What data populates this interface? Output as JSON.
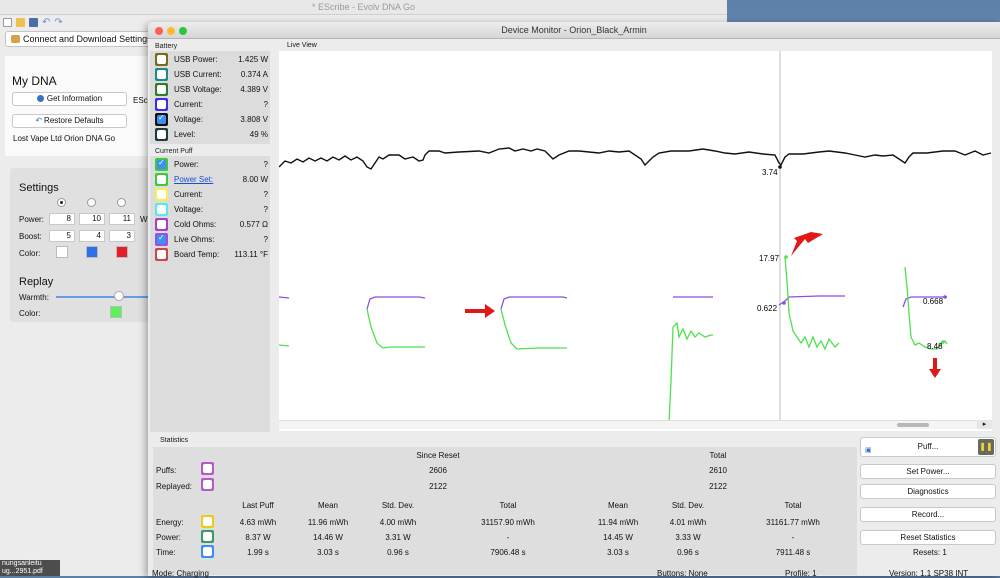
{
  "bg_window": {
    "title": "* EScribe - Evolv DNA Go",
    "connect_button": "Connect and Download Settings",
    "my_dna_title": "My DNA",
    "get_info_button": "Get Information",
    "escribe_label": "ESc",
    "restore_button": "Restore Defaults",
    "device_name": "Lost Vape Ltd Orion DNA Go",
    "settings_title": "Settings",
    "power_label": "Power:",
    "power_values": [
      "8",
      "10",
      "11"
    ],
    "power_unit": "W",
    "boost_label": "Boost:",
    "boost_values": [
      "5",
      "4",
      "3"
    ],
    "color_label": "Color:",
    "color_swatches": [
      "#ffffff",
      "#2f6fe8",
      "#e3202a"
    ],
    "replay_title": "Replay",
    "warmth_label": "Warmth:",
    "replay_color_label": "Color:",
    "replay_color": "#5cf05a",
    "warmth_level": 0.67,
    "desktop_text": [
      "nungsanleitu",
      "ug...2951.pdf"
    ]
  },
  "monitor": {
    "title": "Device Monitor - Orion_Black_Armin",
    "battery_label": "Battery",
    "battery": [
      {
        "name": "USB Power:",
        "value": "1.425 W",
        "color": "#7b6a1a",
        "checked": false
      },
      {
        "name": "USB Current:",
        "value": "0.374 A",
        "color": "#1a8a8a",
        "checked": false
      },
      {
        "name": "USB Voltage:",
        "value": "4.389 V",
        "color": "#2e7d2e",
        "checked": false
      },
      {
        "name": "Current:",
        "value": "?",
        "color": "#3b2de0",
        "checked": false
      },
      {
        "name": "Voltage:",
        "value": "3.808 V",
        "color": "#111111",
        "checked": true
      },
      {
        "name": "Level:",
        "value": "49 %",
        "color": "#1d3b3b",
        "checked": false
      }
    ],
    "current_puff_label": "Current Puff",
    "current_puff": [
      {
        "name": "Power:",
        "value": "?",
        "color": "#3ec83e",
        "checked": true,
        "link": false
      },
      {
        "name": "Power Set:",
        "value": "8.00 W",
        "color": "#3ec83e",
        "checked": false,
        "link": true
      },
      {
        "name": "Current:",
        "value": "?",
        "color": "#f0f05a",
        "checked": false,
        "link": false
      },
      {
        "name": "Voltage:",
        "value": "?",
        "color": "#5ae8e8",
        "checked": false,
        "link": false
      },
      {
        "name": "Cold Ohms:",
        "value": "0.577 Ω",
        "color": "#a340c8",
        "checked": false,
        "link": false
      },
      {
        "name": "Live Ohms:",
        "value": "?",
        "color": "#9a4fe0",
        "checked": true,
        "link": false
      },
      {
        "name": "Board Temp:",
        "value": "113.11 °F",
        "color": "#c84848",
        "checked": false,
        "link": false
      }
    ],
    "live_view_label": "Live View",
    "annotations": [
      "3.74",
      "17.97",
      "0.622",
      "0.668",
      "8.48"
    ],
    "statistics_label": "Statistics",
    "stats": {
      "since_reset": "Since Reset",
      "total": "Total",
      "puffs_label": "Puffs:",
      "puffs_color": "#b75ac9",
      "puffs_since": "2606",
      "puffs_total": "2610",
      "replayed_label": "Replayed:",
      "replayed_color": "#b75ac9",
      "replayed_since": "2122",
      "replayed_total": "2122",
      "col_headers": [
        "Last Puff",
        "Mean",
        "Std. Dev.",
        "Total",
        "Mean",
        "Std. Dev.",
        "Total"
      ],
      "rows": [
        {
          "label": "Energy:",
          "color": "#f0c81e",
          "values": [
            "4.63 mWh",
            "11.96 mWh",
            "4.00 mWh",
            "31157.90 mWh",
            "11.94 mWh",
            "4.01 mWh",
            "31161.77 mWh"
          ]
        },
        {
          "label": "Power:",
          "color": "#3a9a6a",
          "values": [
            "8.37 W",
            "14.46 W",
            "3.31 W",
            "-",
            "14.45 W",
            "3.33 W",
            "-"
          ]
        },
        {
          "label": "Time:",
          "color": "#3a8ff0",
          "values": [
            "1.99 s",
            "3.03 s",
            "0.96 s",
            "7906.48 s",
            "3.03 s",
            "0.96 s",
            "7911.48 s"
          ]
        }
      ]
    },
    "buttons": {
      "puff": "Puff...",
      "set_power": "Set Power...",
      "diagnostics": "Diagnostics",
      "record": "Record...",
      "reset_stats": "Reset Statistics"
    },
    "resets": "Resets: 1",
    "status": {
      "mode": "Mode: Charging",
      "buttons": "Buttons: None",
      "profile": "Profile: 1",
      "version": "Version: 1.1 SP38 INT"
    }
  }
}
